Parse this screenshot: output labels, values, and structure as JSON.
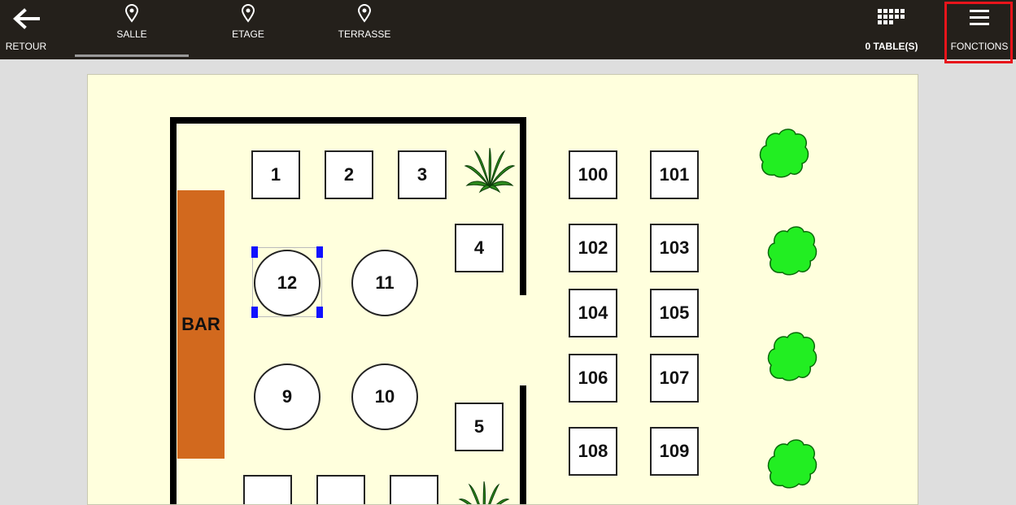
{
  "topbar": {
    "back_label": "RETOUR",
    "tabs": [
      {
        "label": "SALLE",
        "icon": "location-pin-icon",
        "active": true
      },
      {
        "label": "ETAGE",
        "icon": "location-pin-icon",
        "active": false
      },
      {
        "label": "TERRASSE",
        "icon": "location-pin-icon",
        "active": false
      }
    ],
    "tables_label": "0 TABLE(S)",
    "functions_label": "FONCTIONS"
  },
  "floor_plan": {
    "bar_label": "BAR",
    "selected_table": "12",
    "colors": {
      "floor": "#ffffdd",
      "bar": "#d2691e",
      "bush": "#22ee22",
      "highlight": "#e8141b",
      "handle": "#1010ff"
    },
    "tables": [
      {
        "id": "1",
        "shape": "square"
      },
      {
        "id": "2",
        "shape": "square"
      },
      {
        "id": "3",
        "shape": "square"
      },
      {
        "id": "4",
        "shape": "square"
      },
      {
        "id": "5",
        "shape": "square"
      },
      {
        "id": "9",
        "shape": "round"
      },
      {
        "id": "10",
        "shape": "round"
      },
      {
        "id": "11",
        "shape": "round"
      },
      {
        "id": "12",
        "shape": "round"
      },
      {
        "id": "100",
        "shape": "square"
      },
      {
        "id": "101",
        "shape": "square"
      },
      {
        "id": "102",
        "shape": "square"
      },
      {
        "id": "103",
        "shape": "square"
      },
      {
        "id": "104",
        "shape": "square"
      },
      {
        "id": "105",
        "shape": "square"
      },
      {
        "id": "106",
        "shape": "square"
      },
      {
        "id": "107",
        "shape": "square"
      },
      {
        "id": "108",
        "shape": "square"
      },
      {
        "id": "109",
        "shape": "square"
      }
    ],
    "decorations": [
      "palm-plant-icon",
      "palm-plant-icon",
      "bush-icon",
      "bush-icon",
      "bush-icon",
      "bush-icon"
    ]
  }
}
